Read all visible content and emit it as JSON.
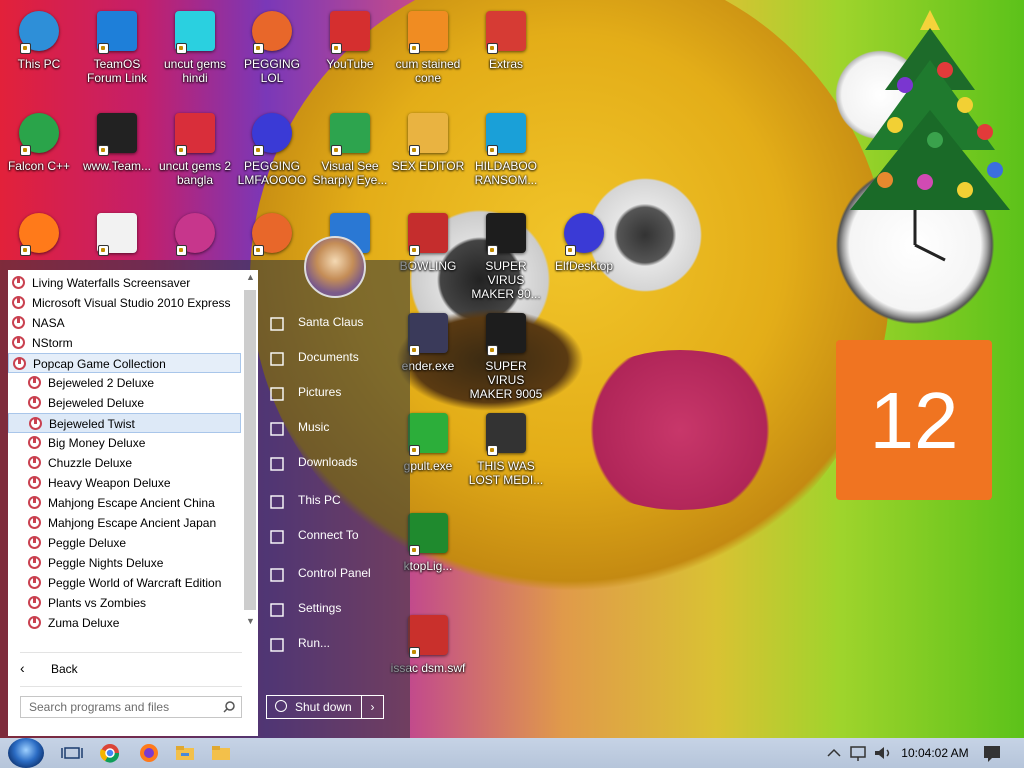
{
  "desktop": {
    "icons": [
      {
        "label": "This PC",
        "icon": "monitor-icon"
      },
      {
        "label": "TeamOS Forum Link",
        "icon": "gear-icon"
      },
      {
        "label": "uncut gems hindi",
        "icon": "diamond-icon"
      },
      {
        "label": "PEGGING LOL",
        "icon": "peggle-icon"
      },
      {
        "label": "YouTube",
        "icon": "angry-bird-icon"
      },
      {
        "label": "cum stained cone",
        "icon": "traffic-cone-icon"
      },
      {
        "label": "Extras",
        "icon": "red-box-icon"
      },
      {
        "label": "Falcon C++",
        "icon": "recycle-icon"
      },
      {
        "label": "www.Team...",
        "icon": "dark-box-icon"
      },
      {
        "label": "uncut gems 2 bangla",
        "icon": "number-two-icon"
      },
      {
        "label": "PEGGING LMFAOOOO",
        "icon": "ornament-icon"
      },
      {
        "label": "Visual See Sharply Eye...",
        "icon": "csharp-icon"
      },
      {
        "label": "SEX EDITOR",
        "icon": "hex-editor-icon"
      },
      {
        "label": "HILDABOO RANSOM...",
        "icon": "wg-icon"
      },
      {
        "label": "",
        "icon": "firefox-icon"
      },
      {
        "label": "",
        "icon": "pixel-dog-icon"
      },
      {
        "label": "",
        "icon": "bejeweled-icon"
      },
      {
        "label": "",
        "icon": "peggle-icon"
      },
      {
        "label": "",
        "icon": "vb-icon"
      },
      {
        "label": "BOWLING",
        "icon": "red-book-icon"
      },
      {
        "label": "SUPER VIRUS MAKER 90...",
        "icon": "camera-bag-icon"
      },
      {
        "label": "ElfDesktop",
        "icon": "ornament-icon"
      },
      {
        "label": "ender.exe",
        "icon": "robot-icon"
      },
      {
        "label": "SUPER VIRUS MAKER 9005",
        "icon": "camera-bag-icon"
      },
      {
        "label": "gpult.exe",
        "icon": "frog-icon"
      },
      {
        "label": "THIS WAS LOST MEDI...",
        "icon": "flag-box-icon"
      },
      {
        "label": "ktopLig...",
        "icon": "christmas-tree-icon"
      },
      {
        "label": "issac dsm.swf",
        "icon": "swf-icon"
      }
    ],
    "calendar_day": "12"
  },
  "start_menu": {
    "programs": [
      {
        "label": "Living Waterfalls Screensaver",
        "level": 0
      },
      {
        "label": "Microsoft Visual Studio 2010 Express",
        "level": 0
      },
      {
        "label": "NASA",
        "level": 0
      },
      {
        "label": "NStorm",
        "level": 0
      },
      {
        "label": "Popcap Game Collection",
        "level": 0,
        "expanded": true
      },
      {
        "label": "Bejeweled 2 Deluxe",
        "level": 1
      },
      {
        "label": "Bejeweled Deluxe",
        "level": 1
      },
      {
        "label": "Bejeweled Twist",
        "level": 1,
        "selected": true
      },
      {
        "label": "Big Money Deluxe",
        "level": 1
      },
      {
        "label": "Chuzzle Deluxe",
        "level": 1
      },
      {
        "label": "Heavy Weapon Deluxe",
        "level": 1
      },
      {
        "label": "Mahjong Escape Ancient China",
        "level": 1
      },
      {
        "label": "Mahjong Escape Ancient Japan",
        "level": 1
      },
      {
        "label": "Peggle Deluxe",
        "level": 1
      },
      {
        "label": "Peggle Nights Deluxe",
        "level": 1
      },
      {
        "label": "Peggle World of Warcraft Edition",
        "level": 1
      },
      {
        "label": "Plants vs Zombies",
        "level": 1
      },
      {
        "label": "Zuma Deluxe",
        "level": 1
      }
    ],
    "back_label": "Back",
    "search_placeholder": "Search programs and files",
    "right_items": [
      {
        "label": "Santa Claus",
        "icon": "user-folder-icon"
      },
      {
        "label": "Documents",
        "icon": "documents-icon"
      },
      {
        "label": "Pictures",
        "icon": "pictures-icon"
      },
      {
        "label": "Music",
        "icon": "music-icon"
      },
      {
        "label": "Downloads",
        "icon": "downloads-icon"
      },
      {
        "label": "This PC",
        "icon": "monitor-icon"
      },
      {
        "label": "Connect To",
        "icon": "connect-icon"
      },
      {
        "label": "Control Panel",
        "icon": "control-panel-icon"
      },
      {
        "label": "Settings",
        "icon": "gear-icon"
      },
      {
        "label": "Run...",
        "icon": "run-icon"
      }
    ],
    "shutdown_label": "Shut down"
  },
  "taskbar": {
    "clock": "10:04:02 AM",
    "pinned": [
      "task-view-icon",
      "chrome-icon",
      "firefox-icon",
      "file-explorer-icon",
      "folder-icon"
    ],
    "tray": [
      "chevron-up-icon",
      "network-icon",
      "volume-icon",
      "notification-icon"
    ]
  }
}
